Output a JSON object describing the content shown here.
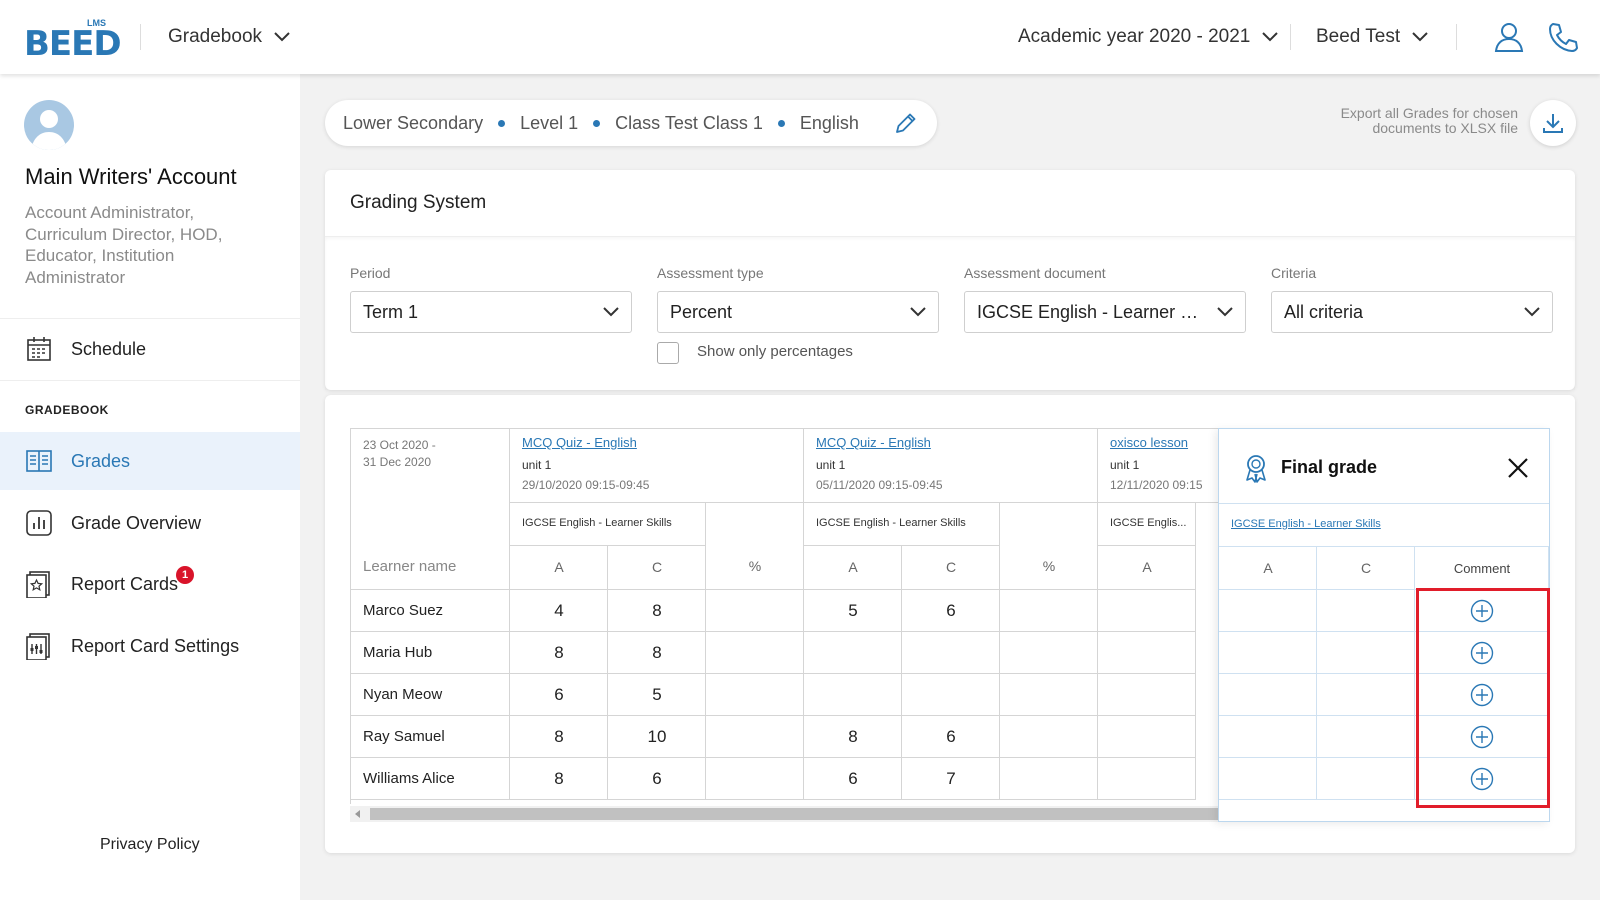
{
  "header": {
    "logo_small": "LMS",
    "logo_word": "BEED",
    "module_label": "Gradebook",
    "academic_year": "Academic year 2020 - 2021",
    "institution": "Beed Test",
    "user_icon": "user-icon",
    "phone_icon": "phone-icon"
  },
  "sidebar": {
    "account_name": "Main Writers' Account",
    "account_roles": "Account Administrator, Curriculum Director, HOD, Educator, Institution Administrator",
    "schedule_label": "Schedule",
    "section_title": "GRADEBOOK",
    "items": [
      {
        "label": "Grades",
        "icon": "book-icon",
        "active": true
      },
      {
        "label": "Grade Overview",
        "icon": "bar-chart-icon",
        "active": false
      },
      {
        "label": "Report Cards",
        "icon": "report-card-icon",
        "active": false,
        "badge": "1"
      },
      {
        "label": "Report Card Settings",
        "icon": "report-settings-icon",
        "active": false
      }
    ],
    "privacy": "Privacy Policy"
  },
  "breadcrumb": [
    "Lower Secondary",
    "Level 1",
    "Class Test Class 1",
    "English"
  ],
  "export": {
    "text": "Export all Grades for chosen documents to XLSX file"
  },
  "grading": {
    "title": "Grading System",
    "filters": {
      "period": {
        "label": "Period",
        "value": "Term 1"
      },
      "assessment_type": {
        "label": "Assessment type",
        "value": "Percent"
      },
      "assessment_document": {
        "label": "Assessment document",
        "value": "IGCSE English - Learner Skills"
      },
      "criteria": {
        "label": "Criteria",
        "value": "All criteria"
      }
    },
    "show_only_percentages": {
      "label": "Show only percentages",
      "checked": false
    }
  },
  "table": {
    "date_range_1": "23 Oct 2020 -",
    "date_range_2": "31 Dec 2020",
    "learner_header": "Learner name",
    "assessments": [
      {
        "title": "MCQ Quiz - English",
        "unit": "unit 1",
        "datetime": "29/10/2020 09:15-09:45",
        "document": "IGCSE English - Learner Skills"
      },
      {
        "title": "MCQ Quiz - English",
        "unit": "unit 1",
        "datetime": "05/11/2020 09:15-09:45",
        "document": "IGCSE English - Learner Skills"
      },
      {
        "title": "oxisco lesson",
        "unit": "unit 1",
        "datetime": "12/11/2020 09:15",
        "document": "IGCSE Englis..."
      }
    ],
    "col_a": "A",
    "col_c": "C",
    "col_pct": "%",
    "rows": [
      {
        "name": "Marco Suez",
        "a1": "4",
        "c1": "8",
        "a2": "5",
        "c2": "6"
      },
      {
        "name": "Maria Hub",
        "a1": "8",
        "c1": "8",
        "a2": "",
        "c2": ""
      },
      {
        "name": "Nyan Meow",
        "a1": "6",
        "c1": "5",
        "a2": "",
        "c2": ""
      },
      {
        "name": "Ray Samuel",
        "a1": "8",
        "c1": "10",
        "a2": "8",
        "c2": "6"
      },
      {
        "name": "Williams Alice",
        "a1": "8",
        "c1": "6",
        "a2": "6",
        "c2": "7"
      }
    ]
  },
  "final_grade": {
    "title": "Final grade",
    "document_link": "IGCSE English - Learner Skills",
    "col_a": "A",
    "col_c": "C",
    "col_comment": "Comment"
  }
}
